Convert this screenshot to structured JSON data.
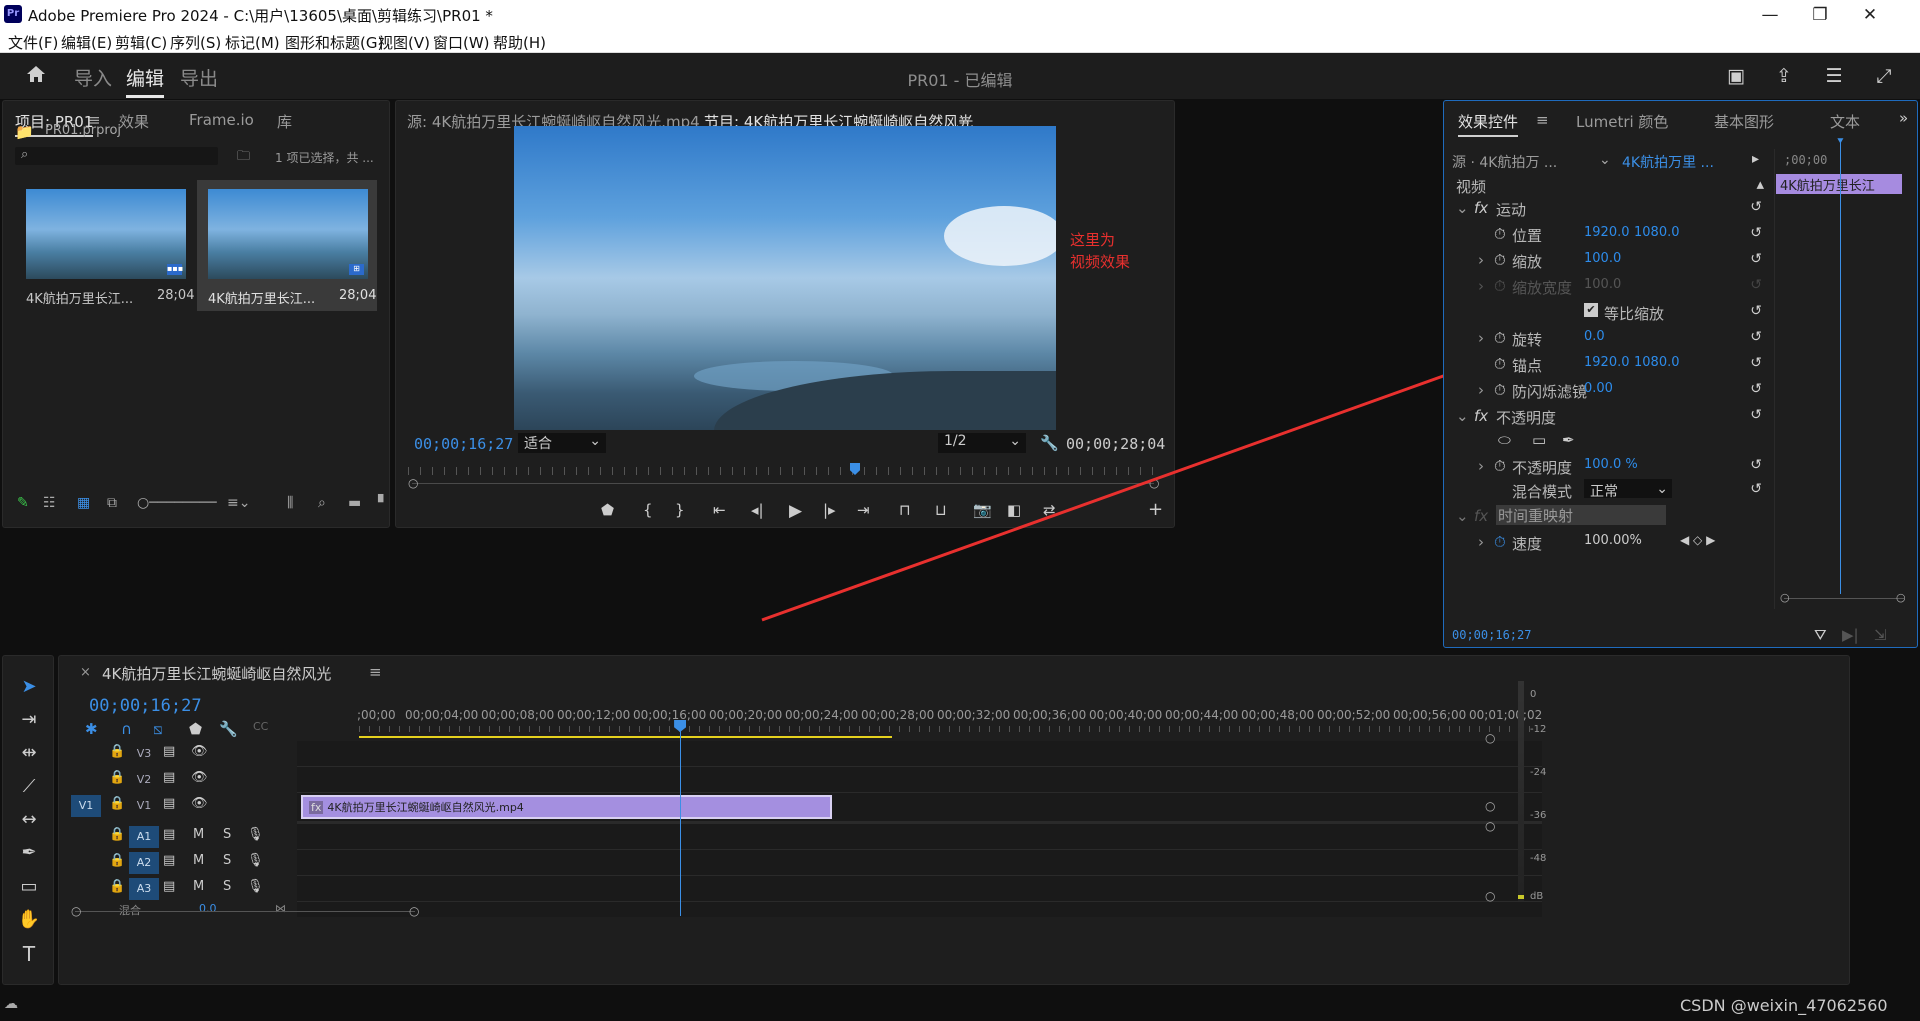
{
  "app": {
    "title": "Adobe Premiere Pro 2024 - C:\\用户\\13605\\桌面\\剪辑练习\\PR01 *",
    "logo": "Pr"
  },
  "window_controls": [
    "minimize",
    "restore",
    "close"
  ],
  "menu": [
    "文件(F)",
    "编辑(E)",
    "剪辑(C)",
    "序列(S)",
    "标记(M)",
    "图形和标题(G)",
    "视图(V)",
    "窗口(W)",
    "帮助(H)"
  ],
  "workspace": {
    "tabs": [
      "导入",
      "编辑",
      "导出"
    ],
    "active": "编辑",
    "doc_title": "PR01 - 已编辑",
    "home_icon": "home-icon",
    "right_icons": [
      "quick-export-icon",
      "share-icon",
      "workspaces-icon",
      "fullscreen-icon"
    ]
  },
  "project": {
    "tabs": [
      "项目: PR01",
      "效果",
      "Frame.io",
      "库"
    ],
    "file": "PR01.prproj",
    "search_placeholder": "",
    "selection_info": "1 项已选择，共 ...",
    "items": [
      {
        "name": "4K航拍万里长江...",
        "duration": "28;04"
      },
      {
        "name": "4K航拍万里长江...",
        "duration": "28;04"
      }
    ]
  },
  "source_tab": "源: 4K航拍万里长江蜿蜒崎岖自然风光.mp4",
  "program": {
    "tab": "节目: 4K航拍万里长江蜿蜒崎岖自然风光",
    "timecode": "00;00;16;27",
    "fit": "适合",
    "resolution": "1/2",
    "duration": "00;00;28;04",
    "playhead_fraction": 0.5976
  },
  "annotation": {
    "line1": "这里为",
    "line2": "视频效果",
    "color": "#e8302e"
  },
  "effect_controls": {
    "tabs": [
      "效果控件",
      "Lumetri 颜色",
      "基本图形",
      "文本"
    ],
    "source": "源 · 4K航拍万 ...",
    "sequence": "4K航拍万里 ...",
    "mini_time": ";00;00",
    "clip_label": "4K航拍万里长江",
    "section": "视频",
    "motion": "运动",
    "position": {
      "label": "位置",
      "x": "1920.0",
      "y": "1080.0"
    },
    "scale": {
      "label": "缩放",
      "value": "100.0"
    },
    "scale_width": {
      "label": "缩放宽度",
      "value": "100.0"
    },
    "uniform": "等比缩放",
    "rotation": {
      "label": "旋转",
      "value": "0.0"
    },
    "anchor": {
      "label": "锚点",
      "x": "1920.0",
      "y": "1080.0"
    },
    "flicker": {
      "label": "防闪烁滤镜",
      "value": "0.00"
    },
    "opacity_group": "不透明度",
    "opacity": {
      "label": "不透明度",
      "value": "100.0 %"
    },
    "blend": {
      "label": "混合模式",
      "value": "正常"
    },
    "time_remap": "时间重映射",
    "speed": {
      "label": "速度",
      "value": "100.00%"
    },
    "timecode": "00;00;16;27"
  },
  "timeline": {
    "seq_name": "4K航拍万里长江蜿蜒崎岖自然风光",
    "timecode": "00;00;16;27",
    "ruler": [
      ";00;00",
      "00;00;04;00",
      "00;00;08;00",
      "00;00;12;00",
      "00;00;16;00",
      "00;00;20;00",
      "00;00;24;00",
      "00;00;28;00",
      "00;00;32;00",
      "00;00;36;00",
      "00;00;40;00",
      "00;00;44;00",
      "00;00;48;00",
      "00;00;52;00",
      "00;00;56;00",
      "00;01;00;02"
    ],
    "video_tracks": [
      "V3",
      "V2",
      "V1"
    ],
    "audio_tracks": [
      "A1",
      "A2",
      "A3"
    ],
    "source_patch_v": "V1",
    "mix_label": "混合",
    "mix_value": "0.0",
    "clip": "4K航拍万里长江蜿蜒崎岖自然风光.mp4",
    "clip_fx": "fx",
    "M": "M",
    "S": "S"
  },
  "meter": {
    "labels": [
      "0",
      "-12",
      "-24",
      "-36",
      "-48",
      "dB"
    ]
  },
  "watermark": "CSDN @weixin_47062560"
}
